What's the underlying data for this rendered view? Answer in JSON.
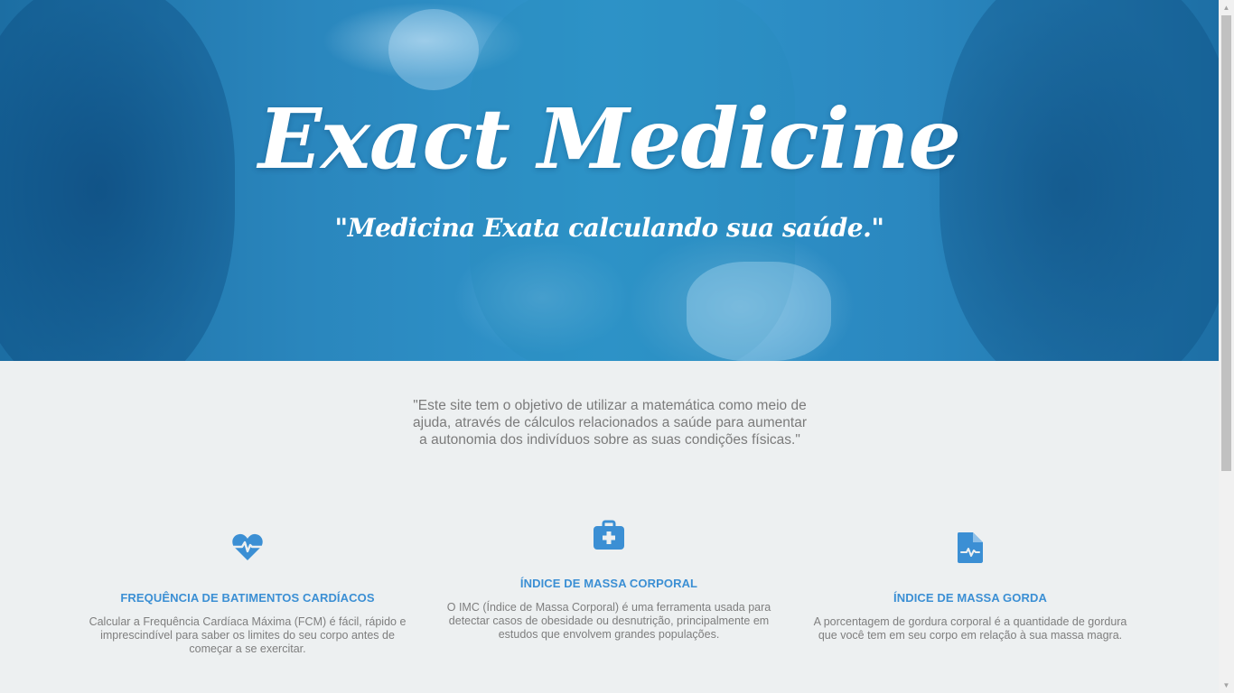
{
  "hero": {
    "title": "Exact Medicine",
    "subtitle": "\"Medicina Exata calculando sua saúde.\""
  },
  "intro": {
    "text": "\"Este site tem o objetivo de utilizar a matemática como meio de ajuda, através de cálculos relacionados a saúde para aumentar a autonomia dos indivíduos sobre as suas condições físicas.\""
  },
  "features": [
    {
      "icon": "heartbeat-icon",
      "title": "FREQUÊNCIA DE BATIMENTOS CARDÍACOS",
      "text": "Calcular a Frequência Cardíaca Máxima (FCM) é fácil, rápido e imprescindível para saber os limites do seu corpo antes de começar a se exercitar."
    },
    {
      "icon": "medkit-icon",
      "title": "ÍNDICE DE MASSA CORPORAL",
      "text": "O IMC (Índice de Massa Corporal) é uma ferramenta usada para detectar casos de obesidade ou desnutrição, principalmente em estudos que envolvem grandes populações."
    },
    {
      "icon": "medical-file-icon",
      "title": "ÍNDICE DE MASSA GORDA",
      "text": "A porcentagem de gordura corporal é a quantidade de gordura que você tem em seu corpo em relação à sua massa magra."
    }
  ],
  "colors": {
    "hero_blue": "#2a86bd",
    "accent": "#3b8fd4",
    "background": "#edf0f1"
  }
}
